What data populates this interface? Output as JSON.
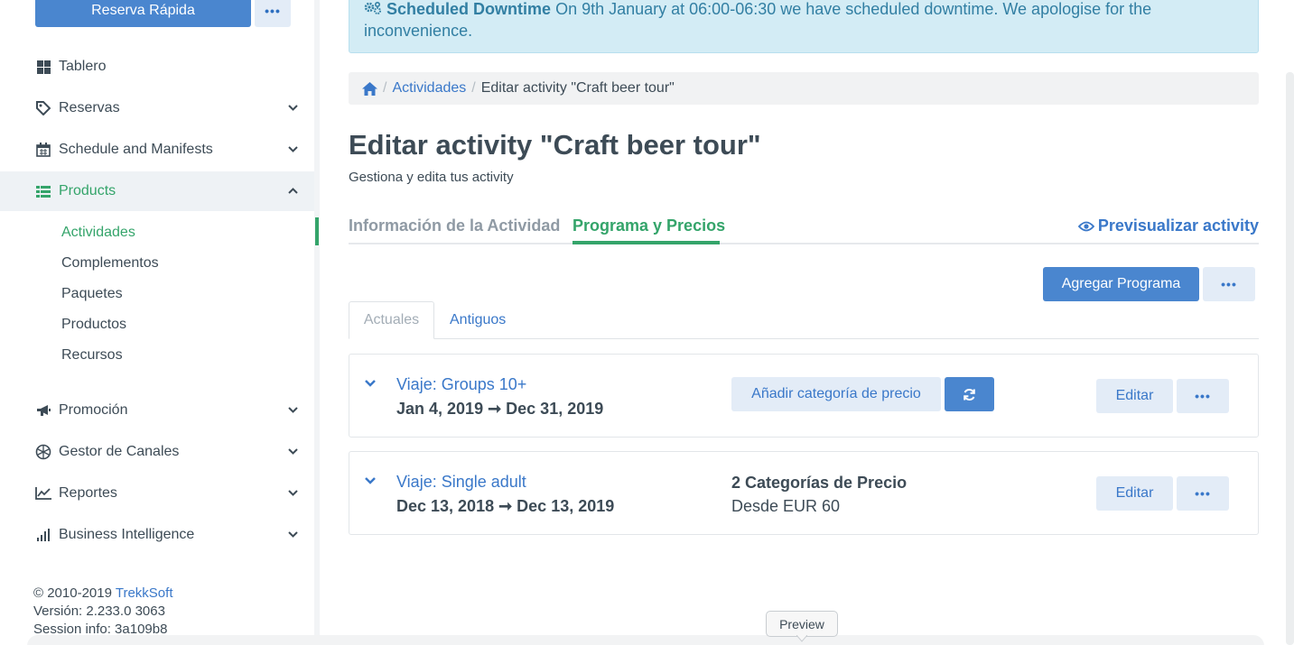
{
  "sidebar": {
    "quick_booking": "Reserva Rápida",
    "more": "•••",
    "items": [
      {
        "label": "Tablero",
        "icon": "dashboard-icon"
      },
      {
        "label": "Reservas",
        "icon": "tag-icon"
      },
      {
        "label": "Schedule and Manifests",
        "icon": "calendar-icon"
      },
      {
        "label": "Products",
        "icon": "list-icon"
      },
      {
        "label": "Promoción",
        "icon": "megaphone-icon"
      },
      {
        "label": "Gestor de Canales",
        "icon": "globe-icon"
      },
      {
        "label": "Reportes",
        "icon": "line-chart-icon"
      },
      {
        "label": "Business Intelligence",
        "icon": "bar-chart-icon"
      }
    ],
    "subitems": [
      "Actividades",
      "Complementos",
      "Paquetes",
      "Productos",
      "Recursos"
    ],
    "footer": {
      "copyright": "© 2010-2019",
      "brand": "TrekkSoft",
      "version": "Versión: 2.233.0 3063",
      "session": "Session info: 3a109b8"
    }
  },
  "alert": {
    "title": "Scheduled Downtime",
    "message": "On 9th January at 06:00-06:30 we have scheduled downtime. We apologise for the inconvenience."
  },
  "breadcrumb": {
    "parent": "Actividades",
    "current": "Editar activity \"Craft beer tour\""
  },
  "page": {
    "title": "Editar activity \"Craft beer tour\"",
    "subtitle": "Gestiona y edita tus activity"
  },
  "tabs": {
    "info": "Información de la Actividad",
    "schedule": "Programa y Precios",
    "preview": "Previsualizar activity"
  },
  "actions": {
    "add_schedule": "Agregar Programa",
    "more": "•••"
  },
  "subtabs": {
    "current": "Actuales",
    "old": "Antiguos"
  },
  "schedules": [
    {
      "title": "Viaje: Groups 10+",
      "dates": "Jan 4, 2019 ➞ Dec 31, 2019",
      "add_price": "Añadir categoría de precio",
      "edit": "Editar",
      "more": "•••"
    },
    {
      "title": "Viaje: Single adult",
      "dates": "Dec 13, 2018 ➞ Dec 13, 2019",
      "price_categories": "2 Categorías de Precio",
      "from": "Desde EUR 60",
      "edit": "Editar",
      "more": "•••"
    }
  ],
  "tooltip": "Preview",
  "colors": {
    "accent_blue": "#4a86cf",
    "link_blue": "#3a78c9",
    "green": "#34a46a",
    "alert_bg": "#d3ecf5"
  }
}
